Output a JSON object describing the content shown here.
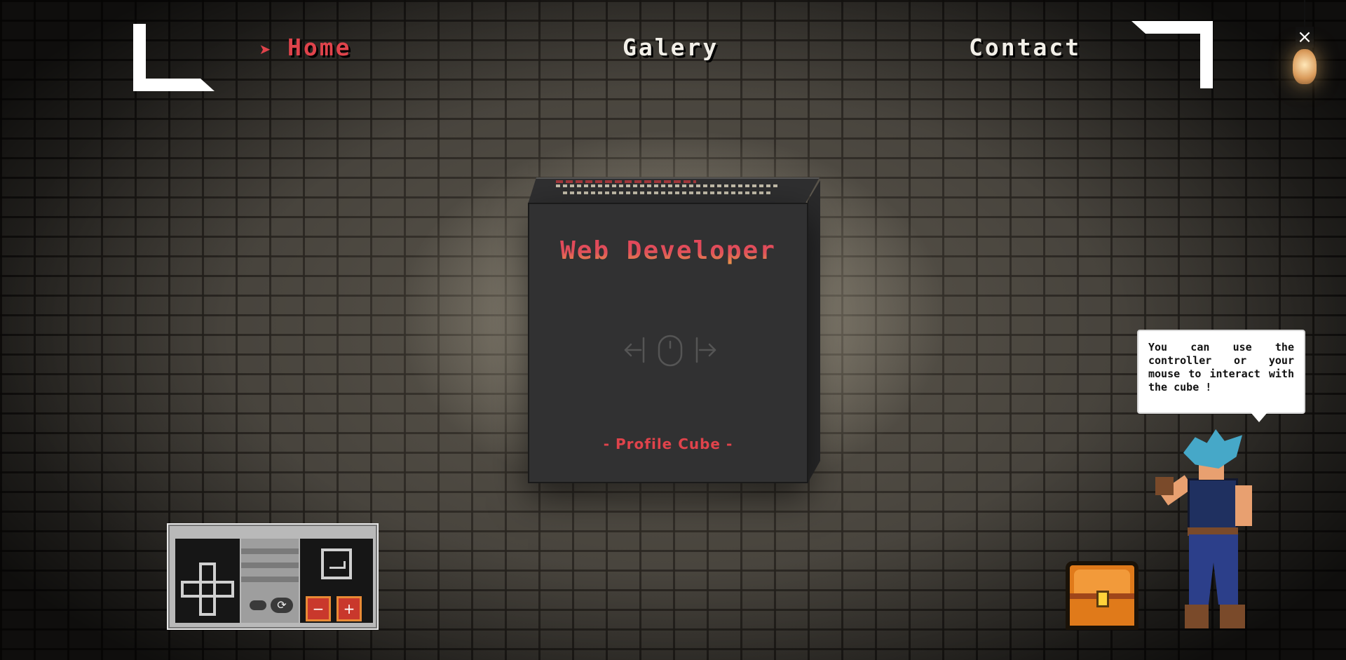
{
  "nav": {
    "arrow": "➤",
    "items": [
      {
        "label": "Home",
        "active": true
      },
      {
        "label": "Galery",
        "active": false
      },
      {
        "label": "Contact",
        "active": false
      }
    ]
  },
  "close_label": "×",
  "cube": {
    "title": "Web Developer",
    "subtitle": "- Profile Cube -"
  },
  "controller": {
    "rotate_label": "⟳",
    "zoom_out_label": "−",
    "zoom_in_label": "+"
  },
  "bubble": {
    "text": "You can use the controller or your mouse to interact with the cube !"
  },
  "colors": {
    "accent_red": "#e0434b",
    "nav_text": "#f2efe8",
    "cube_face": "#313132",
    "chest_orange": "#e07a1a"
  },
  "icons": [
    "close-icon",
    "lightbulb-icon",
    "mouse-drag-hint-icon",
    "dpad-icon",
    "rotate-icon",
    "action-icon",
    "zoom-out-icon",
    "zoom-in-icon",
    "treasure-chest-icon"
  ]
}
